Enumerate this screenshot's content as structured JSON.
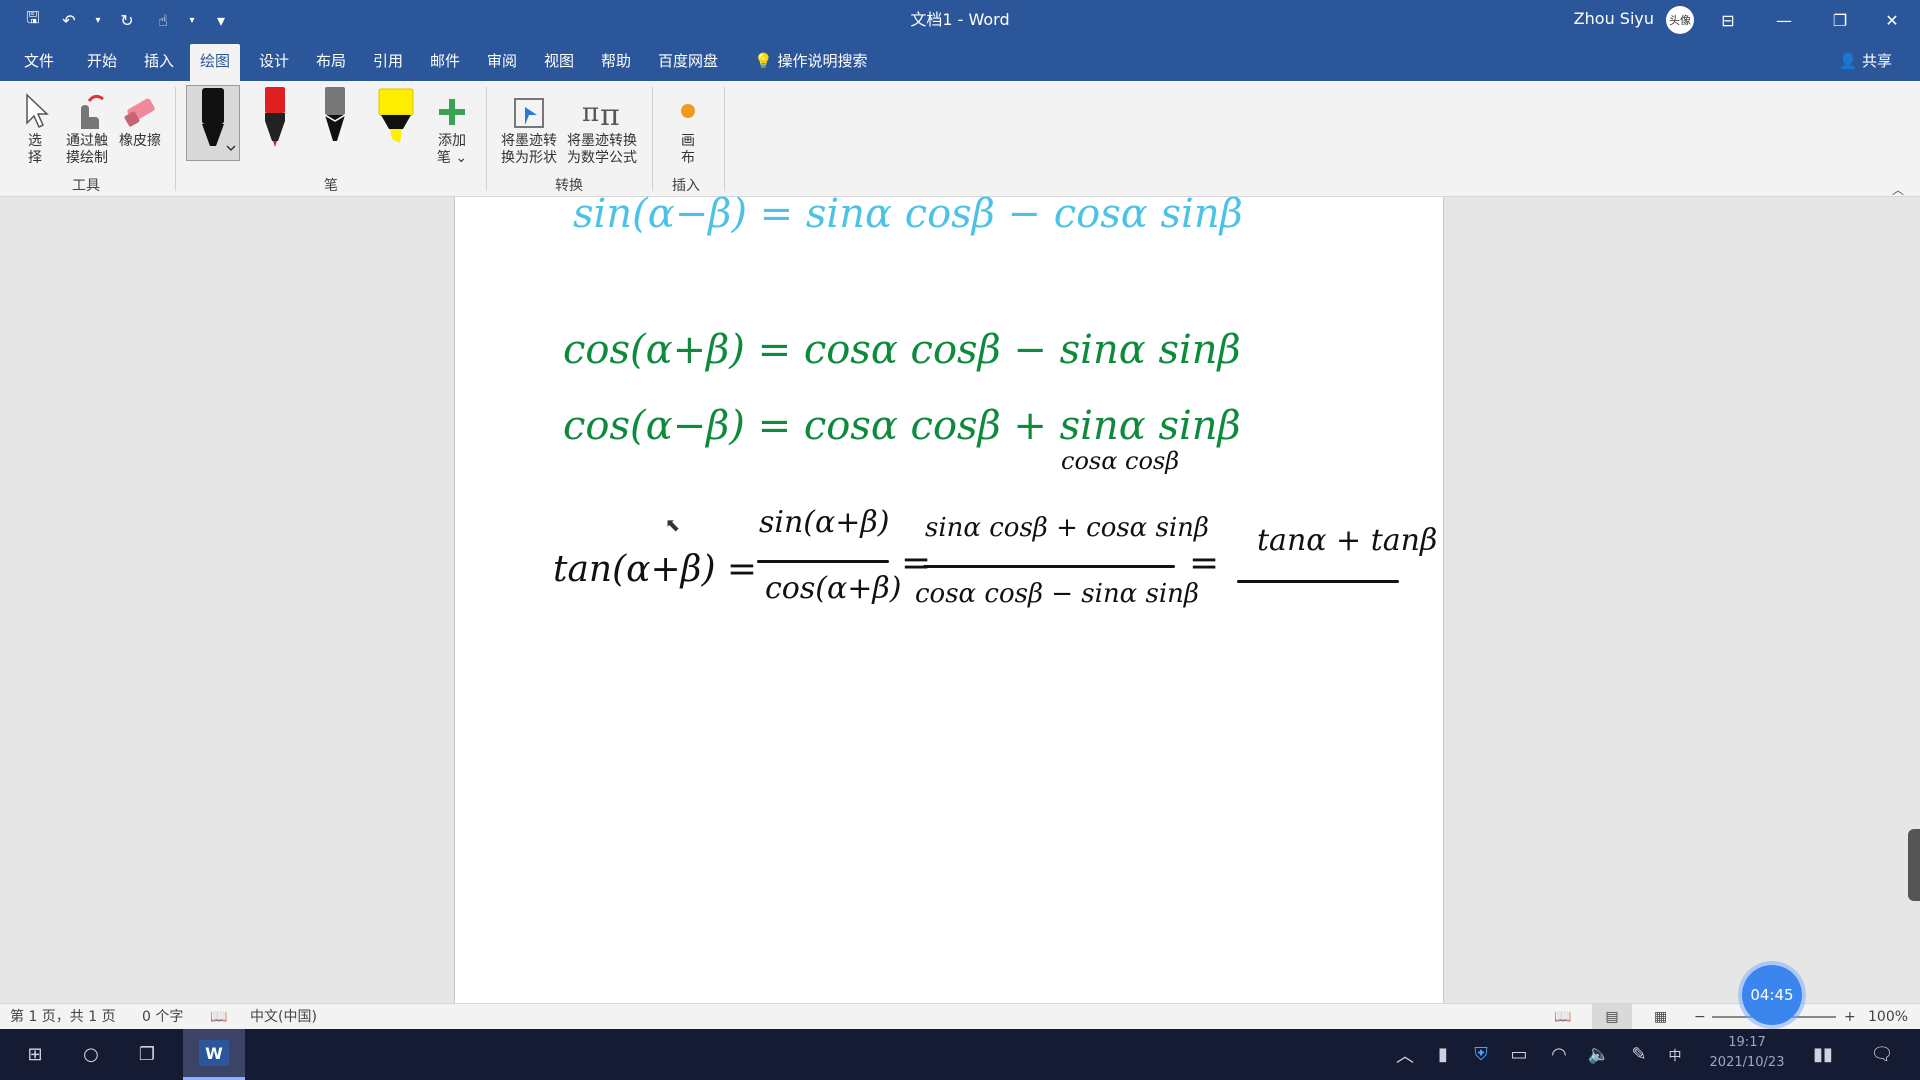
{
  "window": {
    "title": "文档1  -  Word",
    "user": "Zhou Siyu",
    "avatar_text": "头像",
    "controls": [
      "ribbon-display",
      "minimize",
      "restore",
      "close"
    ]
  },
  "quick_access": [
    {
      "name": "save-icon",
      "glyph": "🖫"
    },
    {
      "name": "undo-icon",
      "glyph": "↶"
    },
    {
      "name": "redo-icon",
      "glyph": "↻"
    },
    {
      "name": "touch-mode-icon",
      "glyph": "☝"
    },
    {
      "name": "customize-icon",
      "glyph": "▾"
    }
  ],
  "tabs": [
    "文件",
    "开始",
    "插入",
    "绘图",
    "设计",
    "布局",
    "引用",
    "邮件",
    "审阅",
    "视图",
    "帮助",
    "百度网盘"
  ],
  "active_tab": "绘图",
  "tell_me": "操作说明搜索",
  "share": "共享",
  "ribbon": {
    "tools": {
      "label": "工具",
      "select": "选\n择",
      "touch_draw": "通过触\n摸绘制",
      "eraser": "橡皮擦"
    },
    "pens": {
      "label": "笔",
      "items": [
        {
          "color": "#111111",
          "type": "pen",
          "selected": true
        },
        {
          "color": "#e02020",
          "type": "pen",
          "selected": false
        },
        {
          "color": "#555555",
          "type": "pencil",
          "selected": false
        },
        {
          "color": "#ffee00",
          "type": "highlighter",
          "selected": false
        }
      ],
      "add_pen": "添加\n笔 ⌄"
    },
    "convert": {
      "label": "转换",
      "ink_to_shape": "将墨迹转\n换为形状",
      "ink_to_math": "将墨迹转换\n为数学公式"
    },
    "insert": {
      "label": "插入",
      "canvas": "画\n布"
    }
  },
  "document": {
    "ink_lines": [
      {
        "text": "sin(α−β) = sinα cosβ − cosα sinβ",
        "color": "blue"
      },
      {
        "text": "cos(α+β) = cosα cosβ − sinα sinβ",
        "color": "green"
      },
      {
        "text": "cos(α−β) = cosα cosβ + sinα sinβ",
        "color": "green"
      }
    ],
    "tan_equation": {
      "lhs": "tan(α+β) =",
      "frac1_num": "sin(α+β)",
      "frac1_den": "cos(α+β)",
      "eq2": "=",
      "frac2_num": "sinα cosβ + cosα sinβ",
      "frac2_den": "cosα cosβ − sinα sinβ",
      "eq3": "=",
      "frac3_num": "tanα + tanβ",
      "annotation": "cosα cosβ"
    }
  },
  "status": {
    "page": "第 1 页，共 1 页",
    "words": "0 个字",
    "language": "中文(中国)",
    "zoom_minus": "−",
    "zoom_plus": "+",
    "zoom": "100%",
    "zoom_level": 0.5
  },
  "timer": "04:45",
  "taskbar": {
    "time": "19:17",
    "date": "2021/10/23"
  }
}
